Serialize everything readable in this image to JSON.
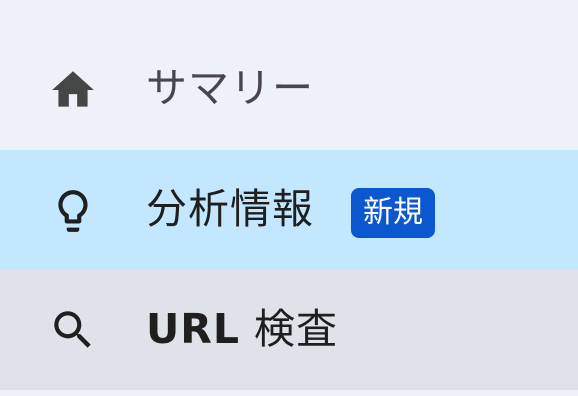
{
  "nav": {
    "items": [
      {
        "label": "サマリー",
        "icon": "home-icon",
        "state": "default"
      },
      {
        "label": "分析情報",
        "icon": "lightbulb-icon",
        "state": "selected",
        "badge": "新規"
      },
      {
        "label_bold": "URL",
        "label_rest": " 検査",
        "icon": "search-icon",
        "state": "hover"
      }
    ]
  },
  "colors": {
    "background": "#eef2f8",
    "selected_bg": "#c2e7ff",
    "hover_bg": "#dfe3e9",
    "badge_bg": "#0b57d0",
    "badge_text": "#ffffff",
    "text_default": "#49454f",
    "text_active": "#1f1f1f"
  }
}
